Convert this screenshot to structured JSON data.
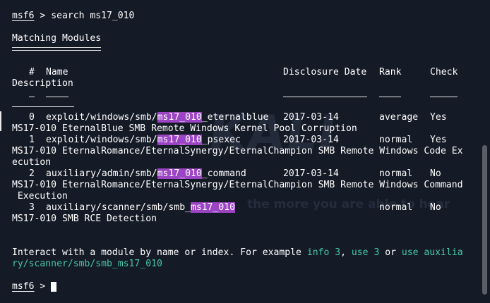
{
  "prompt": "msf6",
  "command": " > search ms17_010",
  "heading": "Matching Modules",
  "columns": {
    "num": "#",
    "name": "Name",
    "date": "Disclosure Date",
    "rank": "Rank",
    "check": "Check",
    "description": "Description"
  },
  "modules": [
    {
      "num": "0",
      "path_prefix": "exploit/windows/smb/",
      "match": "ms17_010",
      "path_suffix": "_eternalblue",
      "date": "2017-03-14",
      "rank": "average",
      "check": "Yes",
      "desc1": "MS17-010 EternalBlue SMB Remote Windows Kernel Pool Corruption",
      "desc2": ""
    },
    {
      "num": "1",
      "path_prefix": "exploit/windows/smb/",
      "match": "ms17_010",
      "path_suffix": "_psexec",
      "date": "2017-03-14",
      "rank": "normal",
      "check": "Yes",
      "desc1": "MS17-010 EternalRomance/EternalSynergy/EternalChampion SMB Remote Windows Code Ex",
      "desc2": "ecution"
    },
    {
      "num": "2",
      "path_prefix": "auxiliary/admin/smb/",
      "match": "ms17_010",
      "path_suffix": "_command",
      "date": "2017-03-14",
      "rank": "normal",
      "check": "No",
      "desc1": "MS17-010 EternalRomance/EternalSynergy/EternalChampion SMB Remote Windows Command",
      "desc2": " Execution"
    },
    {
      "num": "3",
      "path_prefix": "auxiliary/scanner/smb/smb_",
      "match": "ms17_010",
      "path_suffix": "",
      "date": "",
      "rank": "normal",
      "check": "No",
      "desc1": "MS17-010 SMB RCE Detection",
      "desc2": ""
    }
  ],
  "interact": {
    "text1": "Interact with a module by name or index. For example ",
    "cmd1": "info 3",
    "sep1": ", ",
    "cmd2": "use 3",
    "sep2": " or ",
    "cmd3_part1": "use auxilia",
    "cmd3_part2": "ry/scanner/smb/smb_ms17_010"
  },
  "final_prompt": "msf6",
  "final_sep": " > ",
  "watermark": "KALI",
  "watermark_sub": "the more you are able to hear",
  "colors": {
    "background": "#141a26",
    "highlight": "#9b44c4",
    "command": "#45c9a8",
    "text": "#ffffff"
  }
}
